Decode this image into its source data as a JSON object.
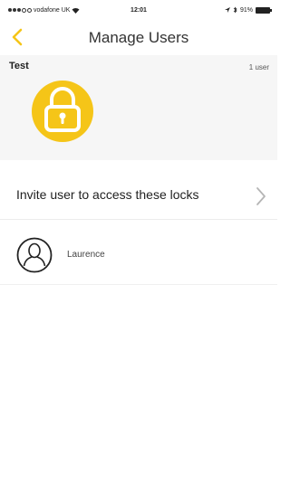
{
  "status_bar": {
    "carrier": "vodafone UK",
    "time": "12:01",
    "battery": "91%"
  },
  "nav": {
    "title": "Manage Users",
    "back_icon": "chevron-left-icon"
  },
  "group": {
    "name": "Test",
    "user_count": "1 user",
    "icon": "padlock-icon"
  },
  "invite": {
    "label": "Invite user to access these locks",
    "icon": "chevron-right-icon"
  },
  "users": [
    {
      "name": "Laurence",
      "icon": "user-avatar-icon"
    }
  ],
  "colors": {
    "accent": "#f5c518",
    "section_background": "#f6f6f6"
  }
}
